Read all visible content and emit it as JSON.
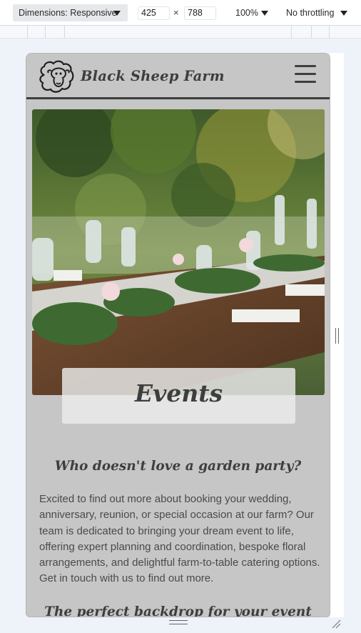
{
  "devtools": {
    "dimensions_label": "Dimensions: Responsive",
    "width": "425",
    "separator": "×",
    "height": "788",
    "zoom": "100%",
    "throttling": "No throttling"
  },
  "site": {
    "brand": "Black Sheep Farm",
    "logo_icon": "sheep-icon",
    "menu_icon": "hamburger-menu-icon"
  },
  "hero": {
    "title": "Events",
    "image": "garden-party-table-photo"
  },
  "content": {
    "heading": "Who doesn't love a garden party?",
    "paragraph": "Excited to find out more about booking your wedding, anniversary, reunion, or special occasion at our farm? Our team is dedicated to bringing your dream event to life, offering expert planning and coordination, bespoke floral arrangements, and delightful farm-to-table catering options. Get in touch with us to find out more.",
    "next_heading": "The perfect backdrop for your event"
  },
  "colors": {
    "page_bg": "#c6c6c6",
    "text_dark": "#3e3e3e",
    "devtools_bg": "#eef2f9"
  }
}
